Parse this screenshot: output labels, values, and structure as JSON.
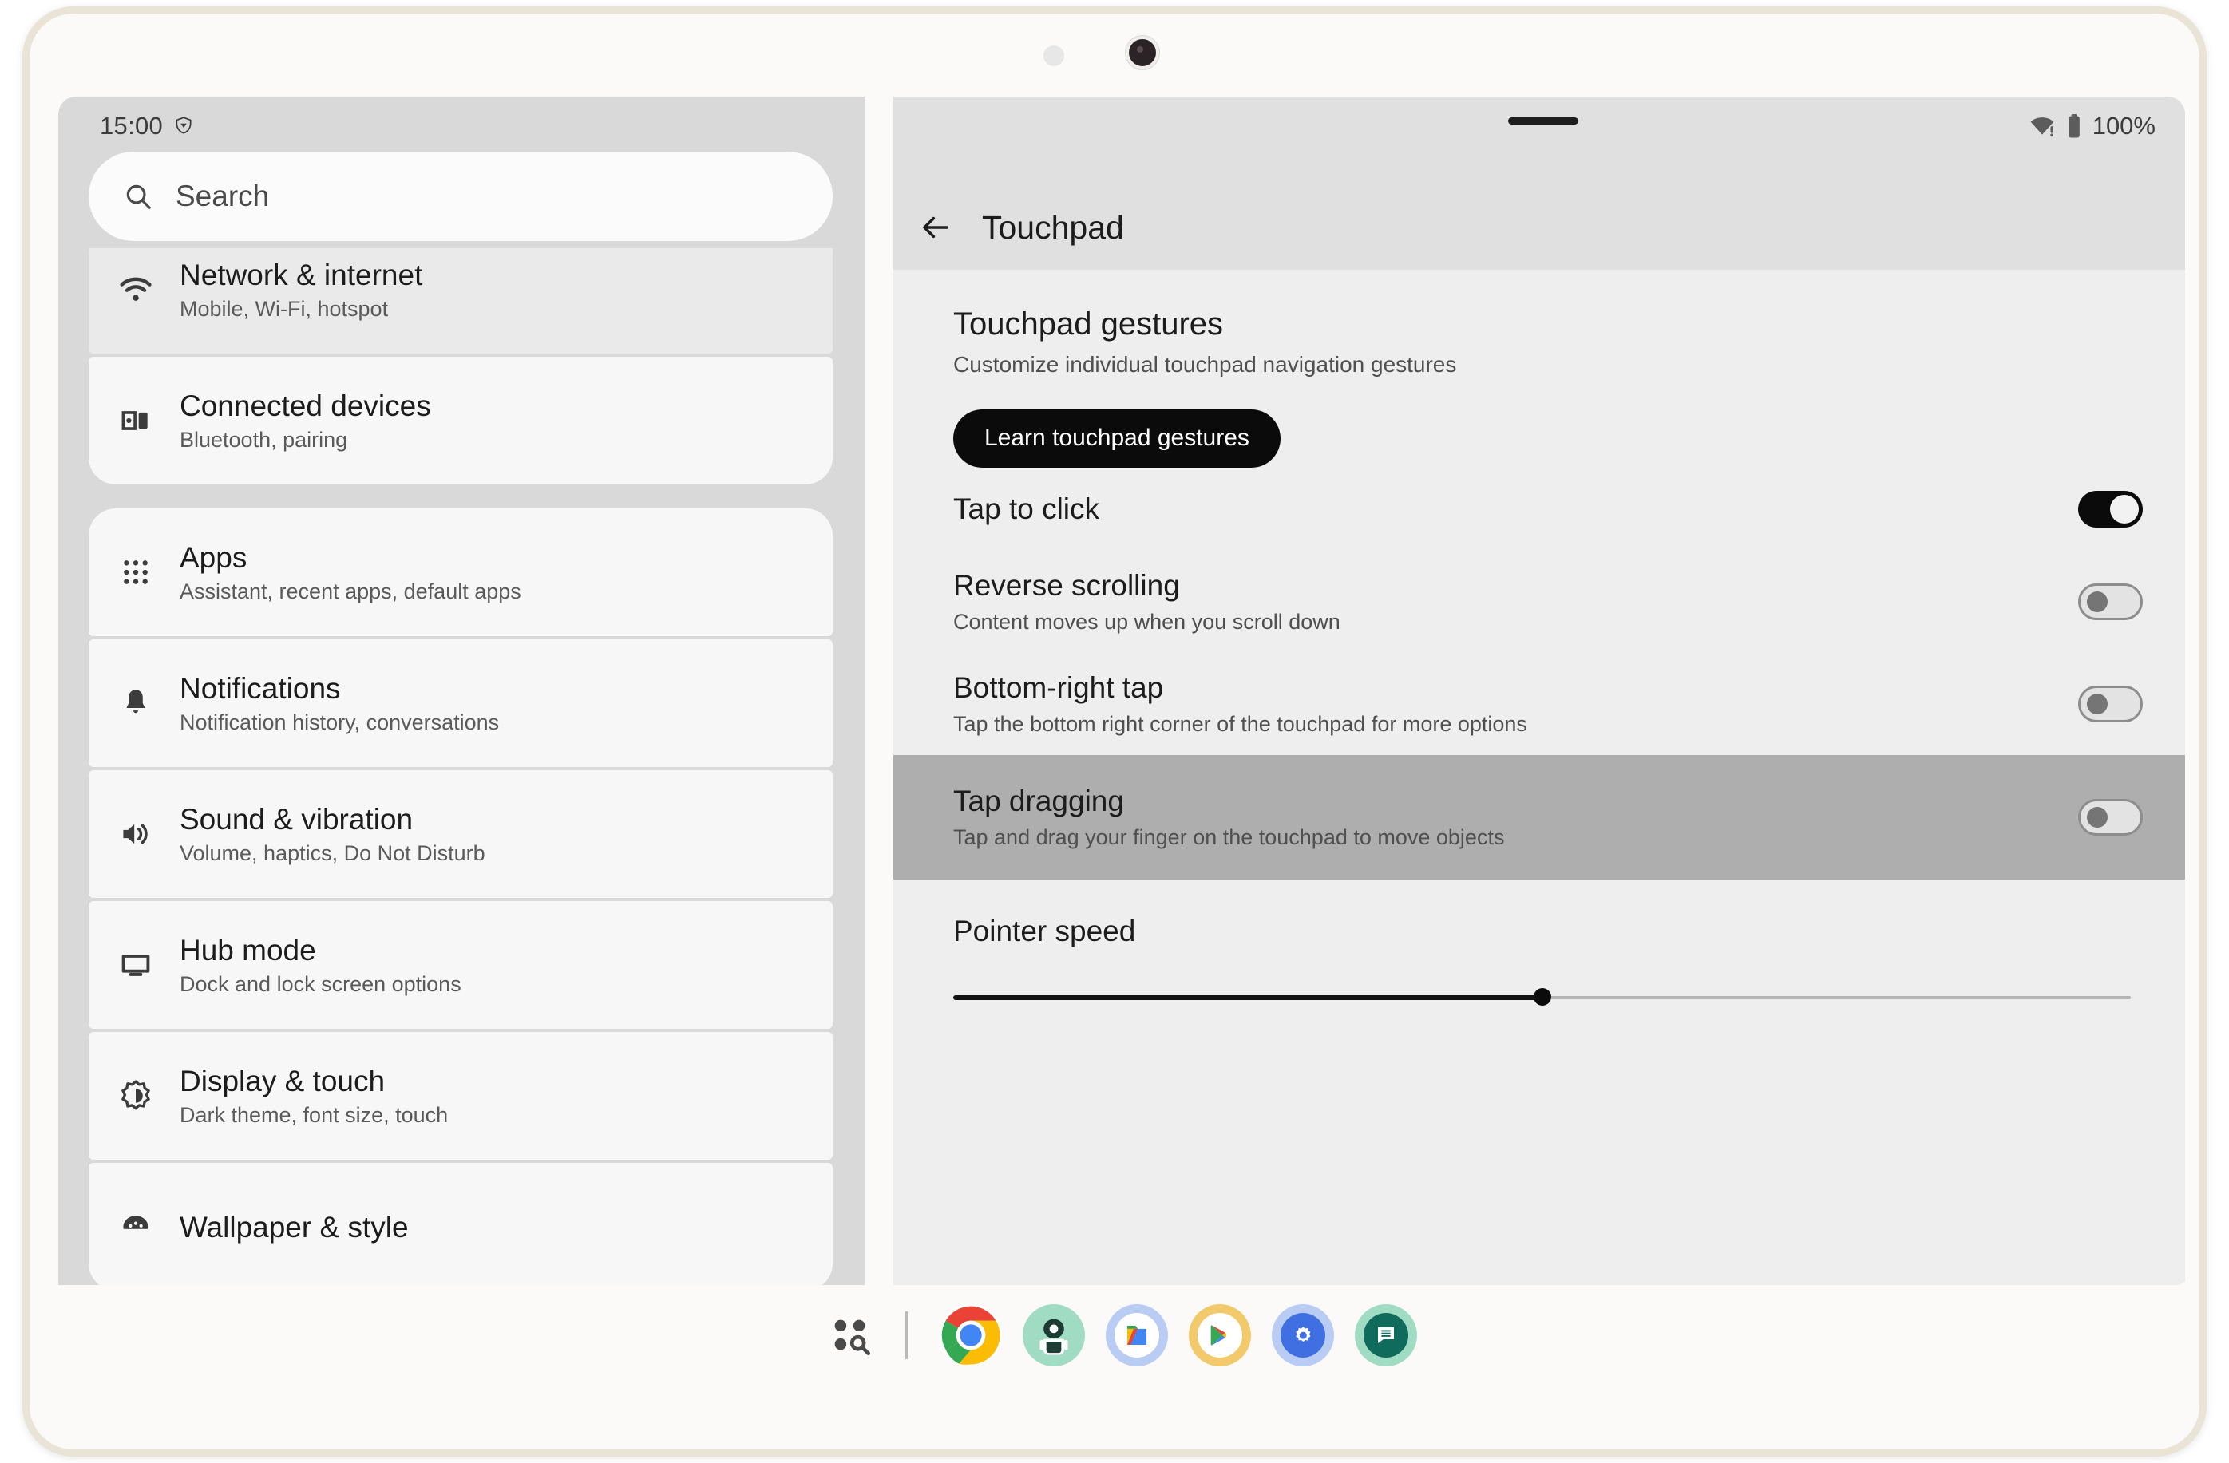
{
  "status_bar": {
    "time": "15:00",
    "vpn_icon": "vpn-shield-icon",
    "wifi_icon": "wifi-no-internet-icon",
    "battery_icon": "battery-full-icon",
    "battery_text": "100%"
  },
  "search": {
    "placeholder": "Search",
    "icon": "search-icon"
  },
  "sidebar": {
    "groups": [
      {
        "items": [
          {
            "title": "Network & internet",
            "subtitle": "Mobile, Wi-Fi, hotspot",
            "icon": "wifi-icon",
            "state": "clipped"
          },
          {
            "title": "Connected devices",
            "subtitle": "Bluetooth, pairing",
            "icon": "devices-icon",
            "state": "normal"
          }
        ]
      },
      {
        "items": [
          {
            "title": "Apps",
            "subtitle": "Assistant, recent apps, default apps",
            "icon": "apps-grid-icon",
            "state": "normal"
          },
          {
            "title": "Notifications",
            "subtitle": "Notification history, conversations",
            "icon": "bell-icon",
            "state": "normal"
          },
          {
            "title": "Sound & vibration",
            "subtitle": "Volume, haptics, Do Not Disturb",
            "icon": "speaker-icon",
            "state": "normal"
          },
          {
            "title": "Hub mode",
            "subtitle": "Dock and lock screen options",
            "icon": "monitor-icon",
            "state": "normal"
          },
          {
            "title": "Display & touch",
            "subtitle": "Dark theme, font size, touch",
            "icon": "brightness-icon",
            "state": "normal"
          },
          {
            "title": "Wallpaper & style",
            "subtitle": "",
            "icon": "palette-icon",
            "state": "cut-off"
          }
        ]
      }
    ]
  },
  "detail": {
    "back_icon": "back-arrow-icon",
    "title": "Touchpad",
    "section": {
      "title": "Touchpad gestures",
      "subtitle": "Customize individual touchpad navigation gestures"
    },
    "learn_button": "Learn touchpad gestures",
    "settings": [
      {
        "title": "Tap to click",
        "subtitle": "",
        "toggle": "on",
        "highlighted": false
      },
      {
        "title": "Reverse scrolling",
        "subtitle": "Content moves up when you scroll down",
        "toggle": "off",
        "highlighted": false
      },
      {
        "title": "Bottom-right tap",
        "subtitle": "Tap the bottom right corner of the touchpad for more options",
        "toggle": "off",
        "highlighted": false
      },
      {
        "title": "Tap dragging",
        "subtitle": "Tap and drag your finger on the touchpad to move objects",
        "toggle": "off",
        "highlighted": true
      }
    ],
    "slider": {
      "label": "Pointer speed",
      "value_percent": 50
    }
  },
  "taskbar": {
    "all_apps_icon": "all-apps-search-icon",
    "apps": [
      {
        "name": "Chrome",
        "icon": "chrome-icon"
      },
      {
        "name": "Android Robot",
        "icon": "android-robot-icon"
      },
      {
        "name": "Files",
        "icon": "files-icon"
      },
      {
        "name": "Play Store",
        "icon": "play-store-icon"
      },
      {
        "name": "Settings",
        "icon": "settings-gear-icon"
      },
      {
        "name": "Messages",
        "icon": "messages-icon"
      }
    ]
  },
  "colors": {
    "accent_black": "#0b0b0b",
    "sidebar_bg": "#d9d9d9",
    "detail_bg": "#eeeeee",
    "highlight_row": "#aeaeae",
    "card_bg": "#f7f7f7",
    "bezel": "#eae4d6"
  }
}
